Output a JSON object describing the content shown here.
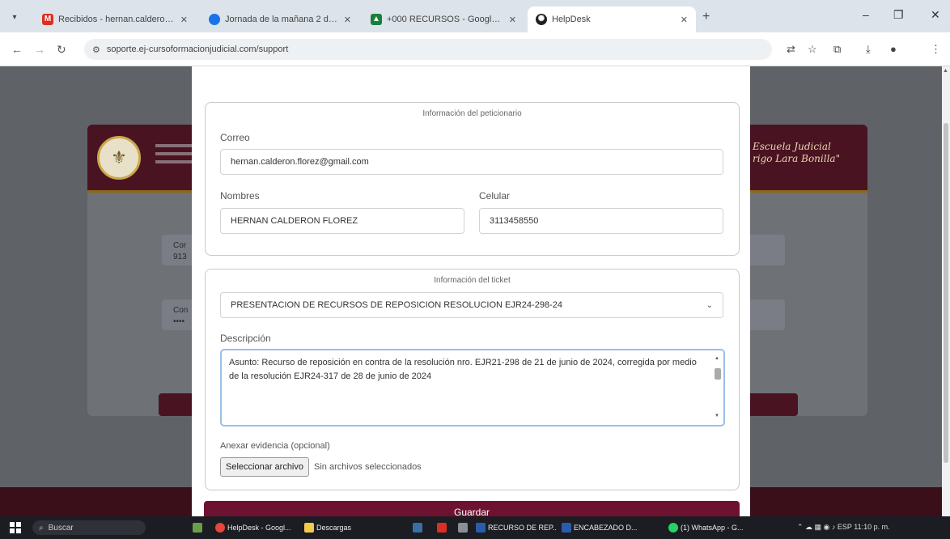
{
  "browser": {
    "tabs": [
      {
        "title": "Recibidos - hernan.calderon.fl",
        "favicon": "gmail-icon",
        "color": "#d93025"
      },
      {
        "title": "Jornada de la mañana 2 de jun",
        "favicon": "blue-drop-icon",
        "color": "#1a73e8"
      },
      {
        "title": "+000 RECURSOS - Google Dri",
        "favicon": "drive-icon",
        "color": "#188038"
      },
      {
        "title": "HelpDesk",
        "favicon": "helpdesk-icon",
        "color": "#202124"
      }
    ],
    "url": "soporte.ej-cursoformacionjudicial.com/support"
  },
  "background": {
    "org_title": "Escuela Judicial",
    "org_subtitle": "rigo Lara Bonilla\"",
    "fragments": [
      "Cor",
      "913",
      "Con",
      "••••"
    ]
  },
  "modal": {
    "requester": {
      "legend": "Información del peticionario",
      "email_label": "Correo",
      "email_value": "hernan.calderon.florez@gmail.com",
      "names_label": "Nombres",
      "names_value": "HERNAN CALDERON FLOREZ",
      "phone_label": "Celular",
      "phone_value": "3113458550"
    },
    "ticket": {
      "legend": "Información del ticket",
      "type_value": "PRESENTACION DE RECURSOS DE REPOSICION RESOLUCION EJR24-298-24",
      "description_label": "Descripción",
      "description_value": "Asunto: Recurso de reposición en contra de la resolución nro. EJR21-298 de 21 de junio de 2024, corregida por medio de la resolución EJR24-317 de 28 de junio de 2024",
      "attach_label": "Anexar evidencia (opcional)",
      "file_button": "Seleccionar archivo",
      "file_status": "Sin archivos seleccionados"
    },
    "save_label": "Guardar"
  },
  "taskbar": {
    "search_placeholder": "Buscar",
    "items": [
      {
        "label": "HelpDesk - Googl...",
        "color": "#e8453c"
      },
      {
        "label": "Descargas",
        "color": "#f2c94c"
      },
      {
        "label": "RECURSO DE REP...",
        "color": "#2b5cab"
      },
      {
        "label": "ENCABEZADO D...",
        "color": "#2b5cab"
      },
      {
        "label": "(1) WhatsApp - G...",
        "color": "#25d366"
      }
    ],
    "tray": "ESP",
    "clock": "11:10 p. m."
  }
}
